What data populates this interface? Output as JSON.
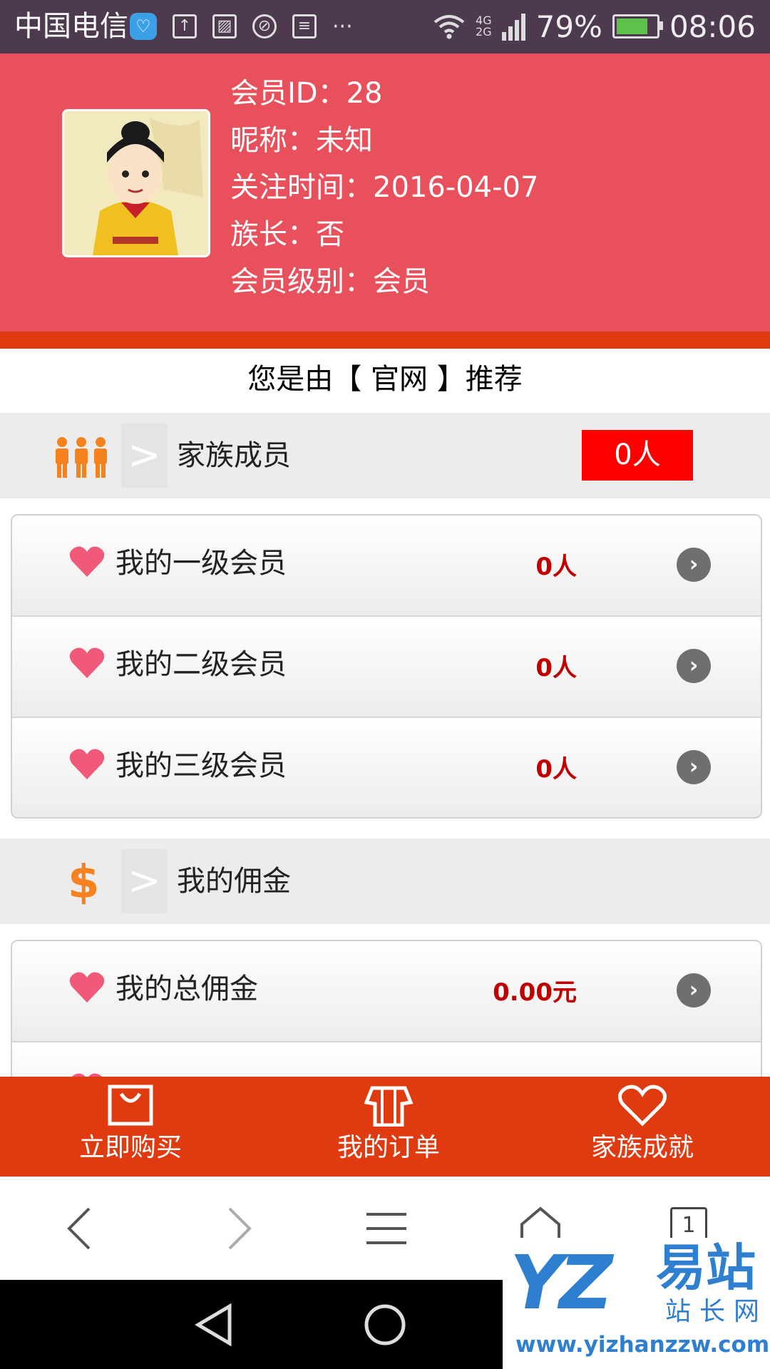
{
  "status_bar": {
    "carrier": "中国电信",
    "battery_percent": "79%",
    "battery_level": 0.79,
    "time": "08:06",
    "network_top": "4G",
    "network_bottom": "2G",
    "icons": [
      "health-badge-icon",
      "upload-icon",
      "image-icon",
      "camera-off-icon",
      "news-icon",
      "more-dots-icon",
      "wifi-icon",
      "signal-icon",
      "battery-icon"
    ]
  },
  "profile": {
    "member_id": "会员ID：28",
    "nickname": "昵称：未知",
    "follow_time": "关注时间：2016-04-07",
    "patriarch": "族长：否",
    "member_level": "会员级别：会员"
  },
  "recommend": {
    "prefix": "您是由",
    "source": "【 官网 】",
    "suffix": "推荐"
  },
  "family_section": {
    "title": "家族成员",
    "count": "0人",
    "items": [
      {
        "label": "我的一级会员",
        "value": "0人"
      },
      {
        "label": "我的二级会员",
        "value": "0人"
      },
      {
        "label": "我的三级会员",
        "value": "0人"
      }
    ]
  },
  "commission_section": {
    "title": "我的佣金",
    "currency_symbol": "$",
    "items": [
      {
        "label": "我的总佣金",
        "value": "0.00元"
      }
    ]
  },
  "bottom_nav": {
    "items": [
      {
        "label": "立即购买",
        "icon": "shopping-bag-icon"
      },
      {
        "label": "我的订单",
        "icon": "shirt-icon"
      },
      {
        "label": "家族成就",
        "icon": "heart-outline-icon"
      }
    ]
  },
  "browser_toolbar": {
    "tab_count": "1"
  },
  "watermark": {
    "logo_text": "YZ",
    "brand_cn_large": "易站",
    "brand_cn_small": "站长网",
    "url": "www.yizhanzzw.com"
  },
  "colors": {
    "header_bg": "#e8505b",
    "accent_orange_red": "#e03a10",
    "count_badge": "#ff0000",
    "value_red": "#c00000",
    "heart_pink": "#f05a78",
    "icon_orange": "#f5821f"
  }
}
